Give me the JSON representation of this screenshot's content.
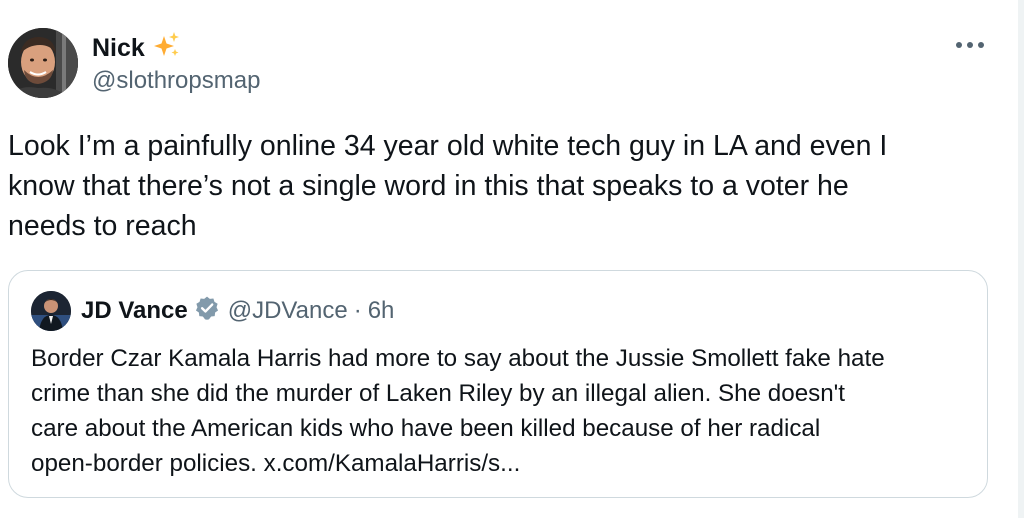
{
  "tweet": {
    "author_name": "Nick",
    "author_handle": "@slothropsmap",
    "text_lines": [
      "Look I’m a painfully online 34 year old white tech guy in LA and even I",
      "know that there’s not a single word in this that speaks to a voter he",
      "needs to reach"
    ],
    "icons": {
      "name_badge": "sparkles-icon",
      "menu": "more-horizontal-icon"
    }
  },
  "quote": {
    "author_name": "JD Vance",
    "author_handle": "@JDVance",
    "separator": "·",
    "time": "6h",
    "text_lines": [
      "Border Czar Kamala Harris had more to say about the Jussie Smollett fake hate",
      "crime than she did the murder of Laken Riley by an illegal alien. She doesn't",
      "care about the American kids who have been killed because of her radical",
      "open-border policies. x.com/KamalaHarris/s..."
    ],
    "icons": {
      "badge": "gray-verified-icon"
    }
  },
  "colors": {
    "text": "#0f1419",
    "secondary": "#536471",
    "border": "#cfd9de",
    "sparkle": "#ffac33",
    "verified_gray": "#829aab"
  }
}
